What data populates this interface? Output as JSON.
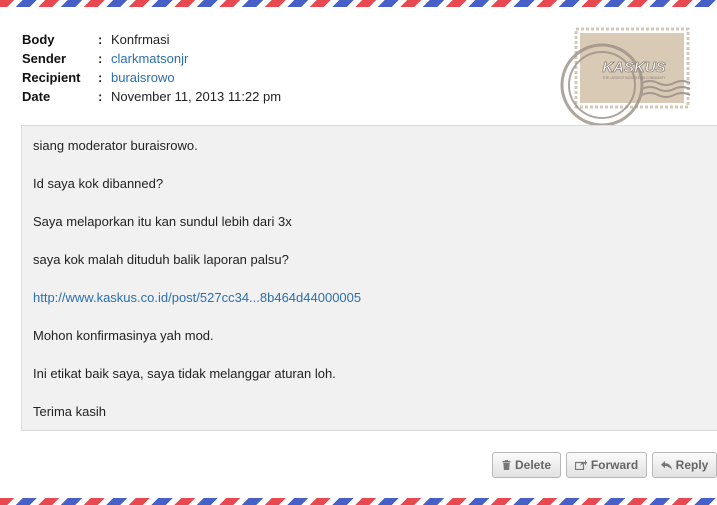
{
  "meta": {
    "body_label": "Body",
    "body_value": "Konfrmasi",
    "sender_label": "Sender",
    "sender_value": "clarkmatsonjr",
    "recipient_label": "Recipient",
    "recipient_value": "buraisrowo",
    "date_label": "Date",
    "date_value": "November 11, 2013 11:22 pm",
    "separator": ":"
  },
  "stamp": {
    "logo_text": "KASKUS",
    "tagline": "THE LARGEST INDONESIAN COMMUNITY"
  },
  "message": {
    "lines": [
      "siang moderator buraisrowo.",
      "Id saya kok dibanned?",
      "Saya melaporkan itu kan sundul lebih dari 3x",
      "saya kok malah dituduh balik laporan palsu?",
      "http://www.kaskus.co.id/post/527cc34...8b464d44000005",
      "Mohon konfirmasinya yah mod.",
      "Ini etikat baik saya, saya tidak melanggar aturan loh.",
      "Terima kasih"
    ]
  },
  "actions": {
    "delete_label": "Delete",
    "forward_label": "Forward",
    "reply_label": "Reply"
  },
  "icons": {
    "delete": "trash-icon",
    "forward": "share-icon",
    "reply": "reply-arrow-icon"
  },
  "colors": {
    "link": "#2a6fb0",
    "airmail_red": "#e8484f",
    "airmail_blue": "#4660c8",
    "message_bg": "#f1f1f1",
    "stamp_bg": "#d8c9b6"
  }
}
